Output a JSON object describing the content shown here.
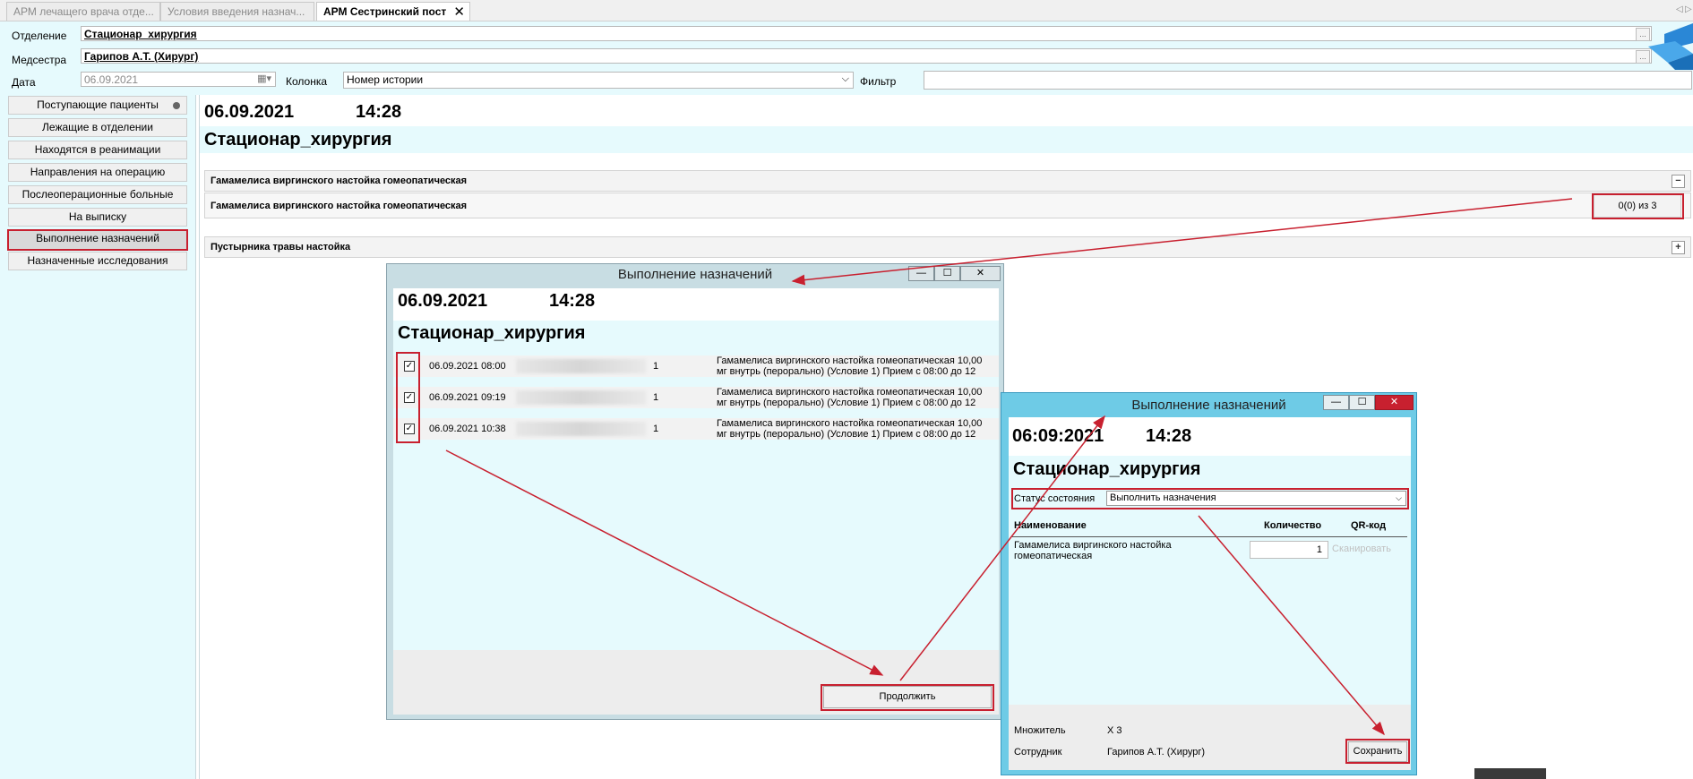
{
  "tabs": [
    {
      "label": "АРМ лечащего врача отде...",
      "active": false
    },
    {
      "label": "Условия введения назнач...",
      "active": false
    },
    {
      "label": "АРМ Сестринский пост",
      "active": true,
      "close": "✕"
    }
  ],
  "header": {
    "department_label": "Отделение",
    "department_value": "Стационар_хирургия",
    "nurse_label": "Медсестра",
    "nurse_value": "Гарипов А.Т. (Хирург)",
    "date_label": "Дата",
    "date_value": "06.09.2021",
    "column_label": "Колонка",
    "column_value": "Номер истории",
    "filter_label": "Фильтр",
    "filter_value": "",
    "dots": "..."
  },
  "nav": {
    "items": [
      {
        "label": "Поступающие пациенты"
      },
      {
        "label": "Лежащие в отделении"
      },
      {
        "label": "Находятся в реанимации"
      },
      {
        "label": "Направления на операцию"
      },
      {
        "label": "Послеоперационные больные"
      },
      {
        "label": "На выписку"
      },
      {
        "label": "Выполнение назначений",
        "selected": true
      },
      {
        "label": "Назначенные исследования"
      }
    ]
  },
  "main": {
    "date": "06.09.2021",
    "time": "14:28",
    "department": "Стационар_хирургия",
    "group1_title": "Гамамелиса виргинского настойка гомеопатическая",
    "group1_collapse": "−",
    "group1_row": "Гамамелиса виргинского настойка гомеопатическая",
    "group1_count": "0(0) из 3",
    "group2_title": "Пустырника травы настойка",
    "group2_expand": "+"
  },
  "dialog1": {
    "title": "Выполнение назначений",
    "minimize": "—",
    "maximize": "☐",
    "close": "✕",
    "date": "06.09.2021",
    "time": "14:28",
    "department": "Стационар_хирургия",
    "rows": [
      {
        "checked": "✓",
        "datetime": "06.09.2021 08:00",
        "qty": "1",
        "desc1": "Гамамелиса виргинского настойка гомеопатическая 10,00",
        "desc2": "мг  внутрь (перорально) (Условие 1)   Прием с 08:00 до 12"
      },
      {
        "checked": "✓",
        "datetime": "06.09.2021 09:19",
        "qty": "1",
        "desc1": "Гамамелиса виргинского настойка гомеопатическая 10,00",
        "desc2": "мг  внутрь (перорально) (Условие 1)   Прием с 08:00 до 12"
      },
      {
        "checked": "✓",
        "datetime": "06.09.2021 10:38",
        "qty": "1",
        "desc1": "Гамамелиса виргинского настойка гомеопатическая 10,00",
        "desc2": "мг  внутрь (перорально) (Условие 1)   Прием с 08:00 до 12"
      }
    ],
    "continue_label": "Продолжить"
  },
  "dialog2": {
    "title": "Выполнение назначений",
    "minimize": "—",
    "maximize": "☐",
    "close": "✕",
    "date": "06:09:2021",
    "time": "14:28",
    "department": "Стационар_хирургия",
    "status_label": "Статус состояния",
    "status_value": "Выполнить назначения",
    "col_name": "Наименование",
    "col_qty": "Количество",
    "col_qr": "QR-код",
    "item_name_1": "Гамамелиса виргинского настойка",
    "item_name_2": "гомеопатическая",
    "item_qty": "1",
    "scan_label": "Сканировать",
    "multiplier_label": "Множитель",
    "multiplier_value": "X 3",
    "employee_label": "Сотрудник",
    "employee_value": "Гарипов А.Т. (Хирург)",
    "save_label": "Сохранить"
  },
  "colors": {
    "accent_red": "#c8202f",
    "panel_bg": "#e6fafd",
    "dialog2_frame": "#6ecbe6"
  }
}
